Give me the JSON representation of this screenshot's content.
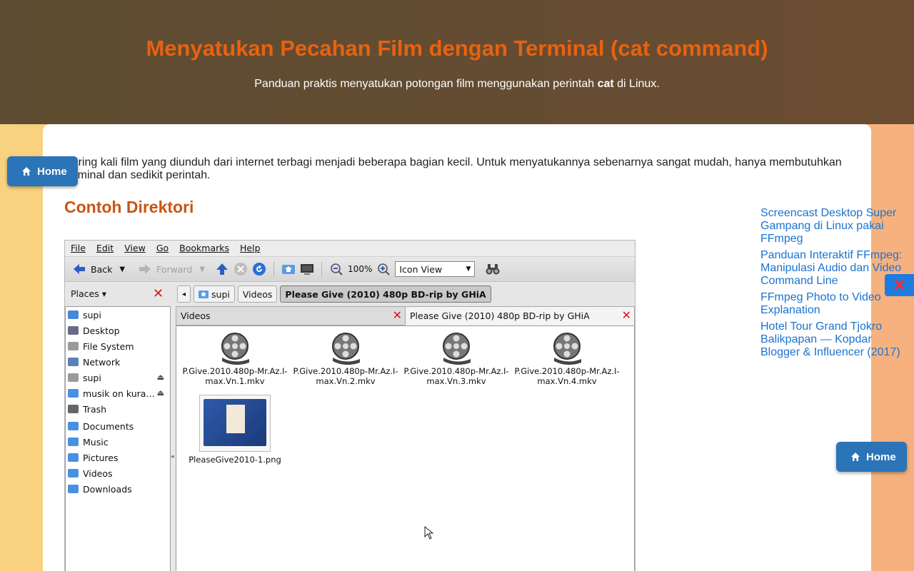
{
  "header": {
    "title": "Menyatukan Pecahan Film dengan Terminal (cat command)",
    "subtitle_pre": "Panduan praktis menyatukan potongan film menggunakan perintah ",
    "subtitle_bold": "cat",
    "subtitle_post": " di Linux."
  },
  "article": {
    "intro": "Sering kali film yang diunduh dari internet terbagi menjadi beberapa bagian kecil. Untuk menyatukannya sebenarnya sangat mudah, hanya membutuhkan terminal dan sedikit perintah.",
    "section_title": "Contoh Direktori"
  },
  "home_button": {
    "label": "Home",
    "icon": "home-icon"
  },
  "sidebar": {
    "links": [
      "Screencast Desktop Super Gampang di Linux pakai FFmpeg",
      "Panduan Interaktif FFmpeg: Manipulasi Audio dan Video Command Line",
      "FFmpeg Photo to Video Explanation",
      "Hotel Tour Grand Tjokro Balikpapan — Kopdar Blogger & Influencer (2017)"
    ],
    "close_icon": "close-icon"
  },
  "file_manager": {
    "menu": [
      "File",
      "Edit",
      "View",
      "Go",
      "Bookmarks",
      "Help"
    ],
    "toolbar": {
      "back": "Back",
      "forward": "Forward",
      "zoom": "100%",
      "view_mode": "Icon View"
    },
    "places_label": "Places ▾",
    "breadcrumbs": [
      "◂",
      "supi",
      "Videos",
      "Please Give (2010) 480p BD-rip by GHiA"
    ],
    "places": [
      {
        "label": "supi",
        "icon": "home-folder-icon",
        "color": "#4a86d8"
      },
      {
        "label": "Desktop",
        "icon": "desktop-icon",
        "color": "#6a6a8a"
      },
      {
        "label": "File System",
        "icon": "drive-icon",
        "color": "#9a9a9a"
      },
      {
        "label": "Network",
        "icon": "network-icon",
        "color": "#5b7fb8"
      },
      {
        "label": "supi",
        "icon": "drive-icon",
        "color": "#9a9a9a"
      },
      {
        "label": "musik on kura…",
        "icon": "folder-icon",
        "color": "#4a90e2"
      },
      {
        "label": "Trash",
        "icon": "trash-icon",
        "color": "#666666"
      },
      {
        "label": "Documents",
        "icon": "folder-icon",
        "color": "#4a90e2"
      },
      {
        "label": "Music",
        "icon": "folder-icon",
        "color": "#4a90e2"
      },
      {
        "label": "Pictures",
        "icon": "folder-icon",
        "color": "#4a90e2"
      },
      {
        "label": "Videos",
        "icon": "folder-icon",
        "color": "#4a90e2"
      },
      {
        "label": "Downloads",
        "icon": "folder-icon",
        "color": "#4a90e2"
      }
    ],
    "tabs": [
      "Videos",
      "Please Give (2010) 480p BD-rip by GHiA"
    ],
    "files": [
      {
        "name_line1": "P.Give.2010.480p-Mr.Az.I-",
        "name_line2": "max.Vn.1.mkv",
        "icon": "video-reel-icon"
      },
      {
        "name_line1": "P.Give.2010.480p-Mr.Az.I-",
        "name_line2": "max.Vn.2.mkv",
        "icon": "video-reel-icon"
      },
      {
        "name_line1": "P.Give.2010.480p-Mr.Az.I-",
        "name_line2": "max.Vn.3.mkv",
        "icon": "video-reel-icon"
      },
      {
        "name_line1": "P.Give.2010.480p-Mr.Az.I-",
        "name_line2": "max.Vn.4.mkv",
        "icon": "video-reel-icon"
      },
      {
        "name_line1": "PleaseGive2010-1.png",
        "name_line2": "",
        "icon": "image-thumbnail"
      }
    ]
  }
}
